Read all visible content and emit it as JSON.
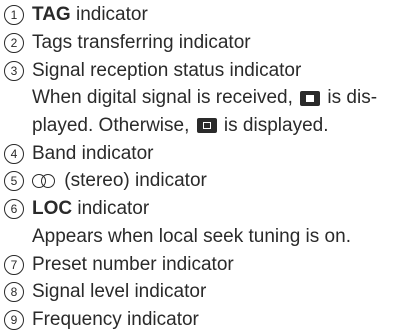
{
  "items": [
    {
      "num": "1",
      "bold": "TAG",
      "text": " indicator"
    },
    {
      "num": "2",
      "text": "Tags transferring indicator"
    },
    {
      "num": "3",
      "text": "Signal reception status indicator",
      "detail_1a": "When digital signal is received, ",
      "detail_1b": " is dis-",
      "detail_2a": "played. Otherwise, ",
      "detail_2b": " is displayed."
    },
    {
      "num": "4",
      "text": "Band indicator"
    },
    {
      "num": "5",
      "text": " (stereo) indicator"
    },
    {
      "num": "6",
      "bold": "LOC",
      "text": " indicator",
      "detail": "Appears when local seek tuning is on."
    },
    {
      "num": "7",
      "text": "Preset number indicator"
    },
    {
      "num": "8",
      "text": "Signal level indicator"
    },
    {
      "num": "9",
      "text": "Frequency indicator"
    }
  ],
  "icons": {
    "signal_received": "digital-signal-received-icon",
    "signal_not_received": "digital-signal-not-received-icon",
    "stereo": "stereo-icon"
  }
}
